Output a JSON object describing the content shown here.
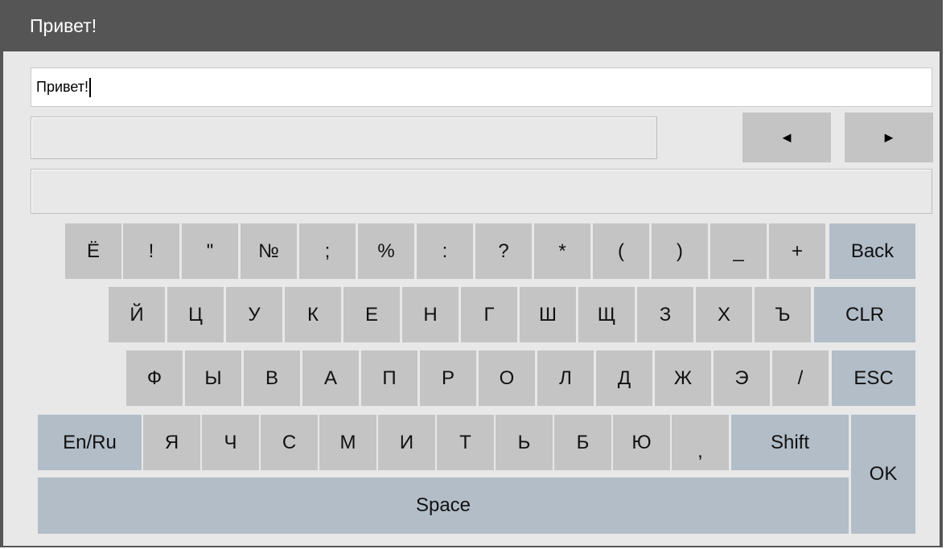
{
  "window": {
    "title": "Привет!"
  },
  "input": {
    "value": "Привет!"
  },
  "nav": {
    "prev_label": "◄",
    "next_label": "►"
  },
  "keyboard": {
    "row1": [
      "Ё",
      "!",
      "\"",
      "№",
      ";",
      "%",
      ":",
      "?",
      "*",
      "(",
      ")",
      "_",
      "+"
    ],
    "back_label": "Back",
    "row2": [
      "Й",
      "Ц",
      "У",
      "К",
      "Е",
      "Н",
      "Г",
      "Ш",
      "Щ",
      "З",
      "Х",
      "Ъ"
    ],
    "clr_label": "CLR",
    "row3": [
      "Ф",
      "Ы",
      "В",
      "А",
      "П",
      "Р",
      "О",
      "Л",
      "Д",
      "Ж",
      "Э",
      "/"
    ],
    "esc_label": "ESC",
    "lang_label": "En/Ru",
    "row4": [
      "Я",
      "Ч",
      "С",
      "М",
      "И",
      "Т",
      "Ь",
      "Б",
      "Ю",
      ","
    ],
    "shift_label": "Shift",
    "ok_label": "OK",
    "space_label": "Space"
  }
}
